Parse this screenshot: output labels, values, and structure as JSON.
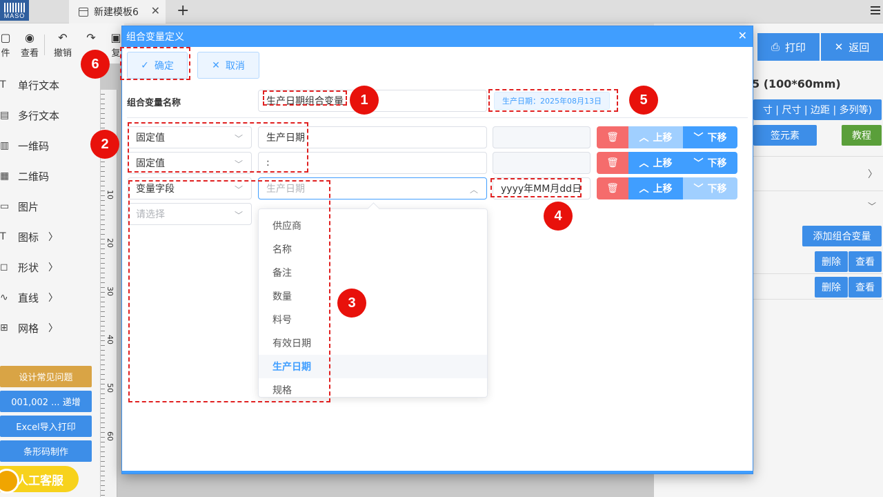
{
  "topbar": {
    "logo_text": "MASO",
    "tab_title": "新建模板6",
    "tab_close": "✕",
    "new_tab": "+"
  },
  "toolbar": {
    "items": [
      {
        "label": "件",
        "icon": "file-icon"
      },
      {
        "label": "查看",
        "icon": "eye-icon"
      },
      {
        "label": "撤销",
        "icon": "undo-icon"
      },
      {
        "label": "",
        "icon": "redo-icon"
      },
      {
        "label": "复",
        "icon": "copy-icon"
      }
    ]
  },
  "sidebar": {
    "items": [
      {
        "label": "单行文本",
        "icon": "T",
        "has_submenu": false
      },
      {
        "label": "多行文本",
        "icon": "▤",
        "has_submenu": false
      },
      {
        "label": "一维码",
        "icon": "▥",
        "has_submenu": false
      },
      {
        "label": "二维码",
        "icon": "▦",
        "has_submenu": false
      },
      {
        "label": "图片",
        "icon": "▭",
        "has_submenu": false
      },
      {
        "label": "图标",
        "icon": "T",
        "has_submenu": true
      },
      {
        "label": "形状",
        "icon": "◻",
        "has_submenu": true
      },
      {
        "label": "直线",
        "icon": "∿",
        "has_submenu": true
      },
      {
        "label": "网格",
        "icon": "⊞",
        "has_submenu": true
      }
    ],
    "buttons": [
      {
        "label": "设计常见问题",
        "color": "#d9a445"
      },
      {
        "label": "001,002 ... 递增",
        "color": "#3d8ee8"
      },
      {
        "label": "Excel导入打印",
        "color": "#3d8ee8"
      },
      {
        "label": "条形码制作",
        "color": "#3d8ee8"
      }
    ],
    "kefu_label": "人工客服"
  },
  "ruler": {
    "ticks": [
      "10",
      "20",
      "30",
      "40",
      "50",
      "60"
    ]
  },
  "right_panel": {
    "print_label": "打印",
    "back_label": "返回",
    "template_title": "5 (100*60mm)",
    "size_button": "寸 | 尺寸 | 边距 | 多列等)",
    "label_elements": "签元素",
    "tutorial": "教程",
    "add_combo_var": "添加组合变量",
    "rows": [
      {
        "delete": "删除",
        "view": "查看"
      },
      {
        "delete": "删除",
        "view": "查看"
      }
    ]
  },
  "dialog": {
    "title": "组合变量定义",
    "confirm": "确定",
    "cancel": "取消",
    "name_label": "组合变量名称",
    "name_value": "生产日期组合变量",
    "preview": "生产日期：2025年08月13日",
    "rows": [
      {
        "type": "固定值",
        "value": "生产日期",
        "format": "",
        "placeholder": false
      },
      {
        "type": "固定值",
        "value": ":",
        "format": "",
        "placeholder": false
      },
      {
        "type": "变量字段",
        "value": "生产日期",
        "format": "yyyy年MM月dd日",
        "placeholder": true
      }
    ],
    "empty_select": "请选择",
    "row_actions": {
      "up": "上移",
      "down": "下移"
    },
    "dropdown_options": [
      {
        "label": "供应商",
        "selected": false
      },
      {
        "label": "名称",
        "selected": false
      },
      {
        "label": "备注",
        "selected": false
      },
      {
        "label": "数量",
        "selected": false
      },
      {
        "label": "料号",
        "selected": false
      },
      {
        "label": "有效日期",
        "selected": false
      },
      {
        "label": "生产日期",
        "selected": true
      },
      {
        "label": "规格",
        "selected": false
      }
    ]
  },
  "annotations": [
    "1",
    "2",
    "3",
    "4",
    "5",
    "6"
  ],
  "colors": {
    "primary": "#409eff",
    "danger": "#f56c6c",
    "annotation": "#e8110b",
    "tutorial": "#5a9f3a"
  }
}
